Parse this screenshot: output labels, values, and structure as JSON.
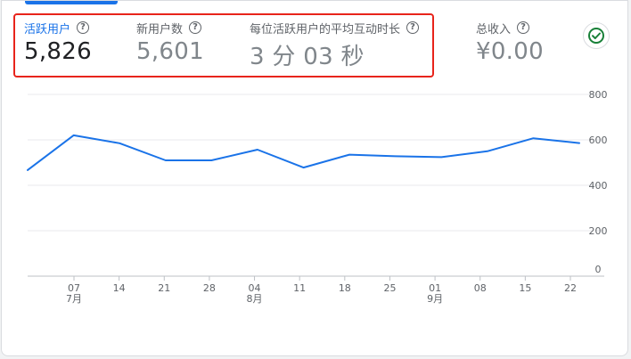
{
  "metrics": [
    {
      "label": "活跃用户",
      "value": "5,826",
      "active": true
    },
    {
      "label": "新用户数",
      "value": "5,601",
      "active": false
    },
    {
      "label": "每位活跃用户的平均互动时长",
      "value": "3 分 03 秒",
      "active": false
    },
    {
      "label": "总收入",
      "value": "¥0.00",
      "active": false
    }
  ],
  "help_glyph": "?",
  "colors": {
    "accent": "#1a73e8",
    "highlight": "#e8241b",
    "check": "#188038"
  },
  "chart_data": {
    "type": "line",
    "series": [
      {
        "values": [
          467,
          620,
          585,
          510,
          510,
          557,
          478,
          535,
          528,
          524,
          550,
          607,
          586
        ]
      }
    ],
    "ylim": [
      0,
      800
    ],
    "y_ticks": [
      "0",
      "200",
      "400",
      "600",
      "800"
    ],
    "x_ticks": [
      {
        "day": "07",
        "month": "7月"
      },
      {
        "day": "14",
        "month": ""
      },
      {
        "day": "21",
        "month": ""
      },
      {
        "day": "28",
        "month": ""
      },
      {
        "day": "04",
        "month": "8月"
      },
      {
        "day": "11",
        "month": ""
      },
      {
        "day": "18",
        "month": ""
      },
      {
        "day": "25",
        "month": ""
      },
      {
        "day": "01",
        "month": "9月"
      },
      {
        "day": "08",
        "month": ""
      },
      {
        "day": "15",
        "month": ""
      },
      {
        "day": "22",
        "month": ""
      }
    ],
    "grid": true,
    "line_color": "#1a73e8"
  }
}
